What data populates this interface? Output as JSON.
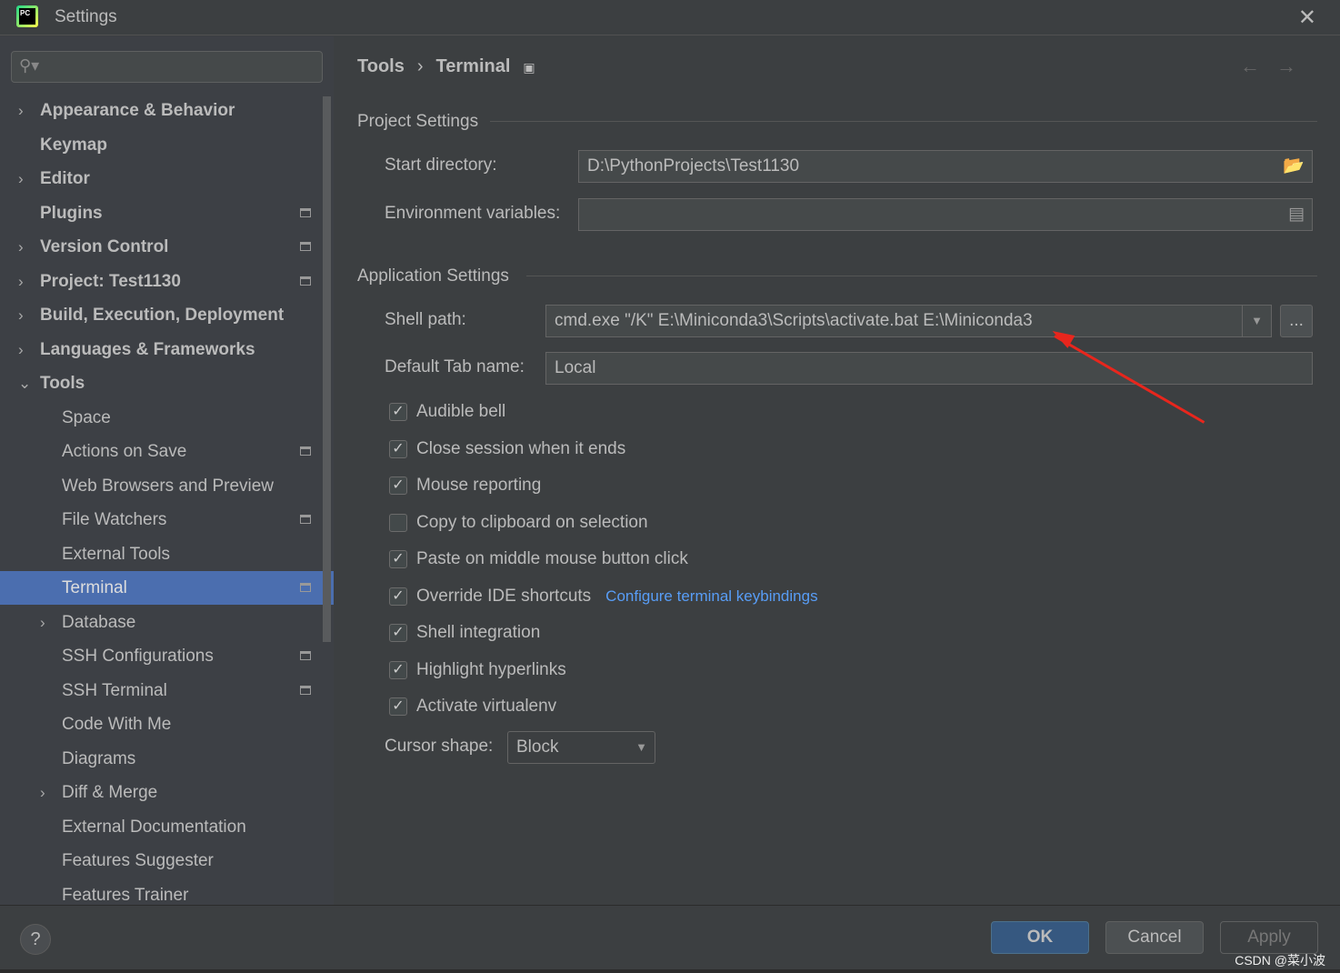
{
  "window": {
    "title": "Settings",
    "logo_text": "PC"
  },
  "sidebar": {
    "items": [
      {
        "label": "Appearance & Behavior",
        "arrow": "›",
        "bold": true,
        "page": false
      },
      {
        "label": "Keymap",
        "bold": true
      },
      {
        "label": "Editor",
        "arrow": "›",
        "bold": true
      },
      {
        "label": "Plugins",
        "bold": true,
        "page": true
      },
      {
        "label": "Version Control",
        "arrow": "›",
        "bold": true,
        "page": true
      },
      {
        "label": "Project: Test1130",
        "arrow": "›",
        "bold": true,
        "page": true
      },
      {
        "label": "Build, Execution, Deployment",
        "arrow": "›",
        "bold": true
      },
      {
        "label": "Languages & Frameworks",
        "arrow": "›",
        "bold": true
      },
      {
        "label": "Tools",
        "arrow": "⌄",
        "bold": true
      },
      {
        "label": "Space"
      },
      {
        "label": "Actions on Save",
        "page": true
      },
      {
        "label": "Web Browsers and Preview"
      },
      {
        "label": "File Watchers",
        "page": true
      },
      {
        "label": "External Tools"
      },
      {
        "label": "Terminal",
        "page": true,
        "selected": true
      },
      {
        "label": "Database",
        "arrow": "›"
      },
      {
        "label": "SSH Configurations",
        "page": true
      },
      {
        "label": "SSH Terminal",
        "page": true
      },
      {
        "label": "Code With Me"
      },
      {
        "label": "Diagrams"
      },
      {
        "label": "Diff & Merge",
        "arrow": "›"
      },
      {
        "label": "External Documentation"
      },
      {
        "label": "Features Suggester"
      },
      {
        "label": "Features Trainer"
      }
    ]
  },
  "breadcrumb": {
    "parent": "Tools",
    "sep": "›",
    "current": "Terminal"
  },
  "project_settings": {
    "title": "Project Settings",
    "start_dir_label": "Start directory:",
    "start_dir": "D:\\PythonProjects\\Test1130",
    "env_label": "Environment variables:",
    "env": ""
  },
  "app_settings": {
    "title": "Application Settings",
    "shell_label": "Shell path:",
    "shell": "cmd.exe \"/K\" E:\\Miniconda3\\Scripts\\activate.bat E:\\Miniconda3",
    "browse": "...",
    "tab_label": "Default Tab name:",
    "tab": "Local",
    "checkboxes": [
      {
        "label": "Audible bell",
        "checked": true
      },
      {
        "label": "Close session when it ends",
        "checked": true
      },
      {
        "label": "Mouse reporting",
        "checked": true
      },
      {
        "label": "Copy to clipboard on selection",
        "checked": false
      },
      {
        "label": "Paste on middle mouse button click",
        "checked": true
      },
      {
        "label": "Override IDE shortcuts",
        "checked": true,
        "link": "Configure terminal keybindings"
      },
      {
        "label": "Shell integration",
        "checked": true
      },
      {
        "label": "Highlight hyperlinks",
        "checked": true
      },
      {
        "label": "Activate virtualenv",
        "checked": true
      }
    ],
    "cursor_label": "Cursor shape:",
    "cursor": "Block"
  },
  "footer": {
    "help": "?",
    "ok": "OK",
    "cancel": "Cancel",
    "apply": "Apply"
  },
  "watermark": "CSDN @菜小波",
  "colors": {
    "selection": "#4b6eaf",
    "link": "#589df6",
    "annotation_arrow": "#e8261d"
  }
}
